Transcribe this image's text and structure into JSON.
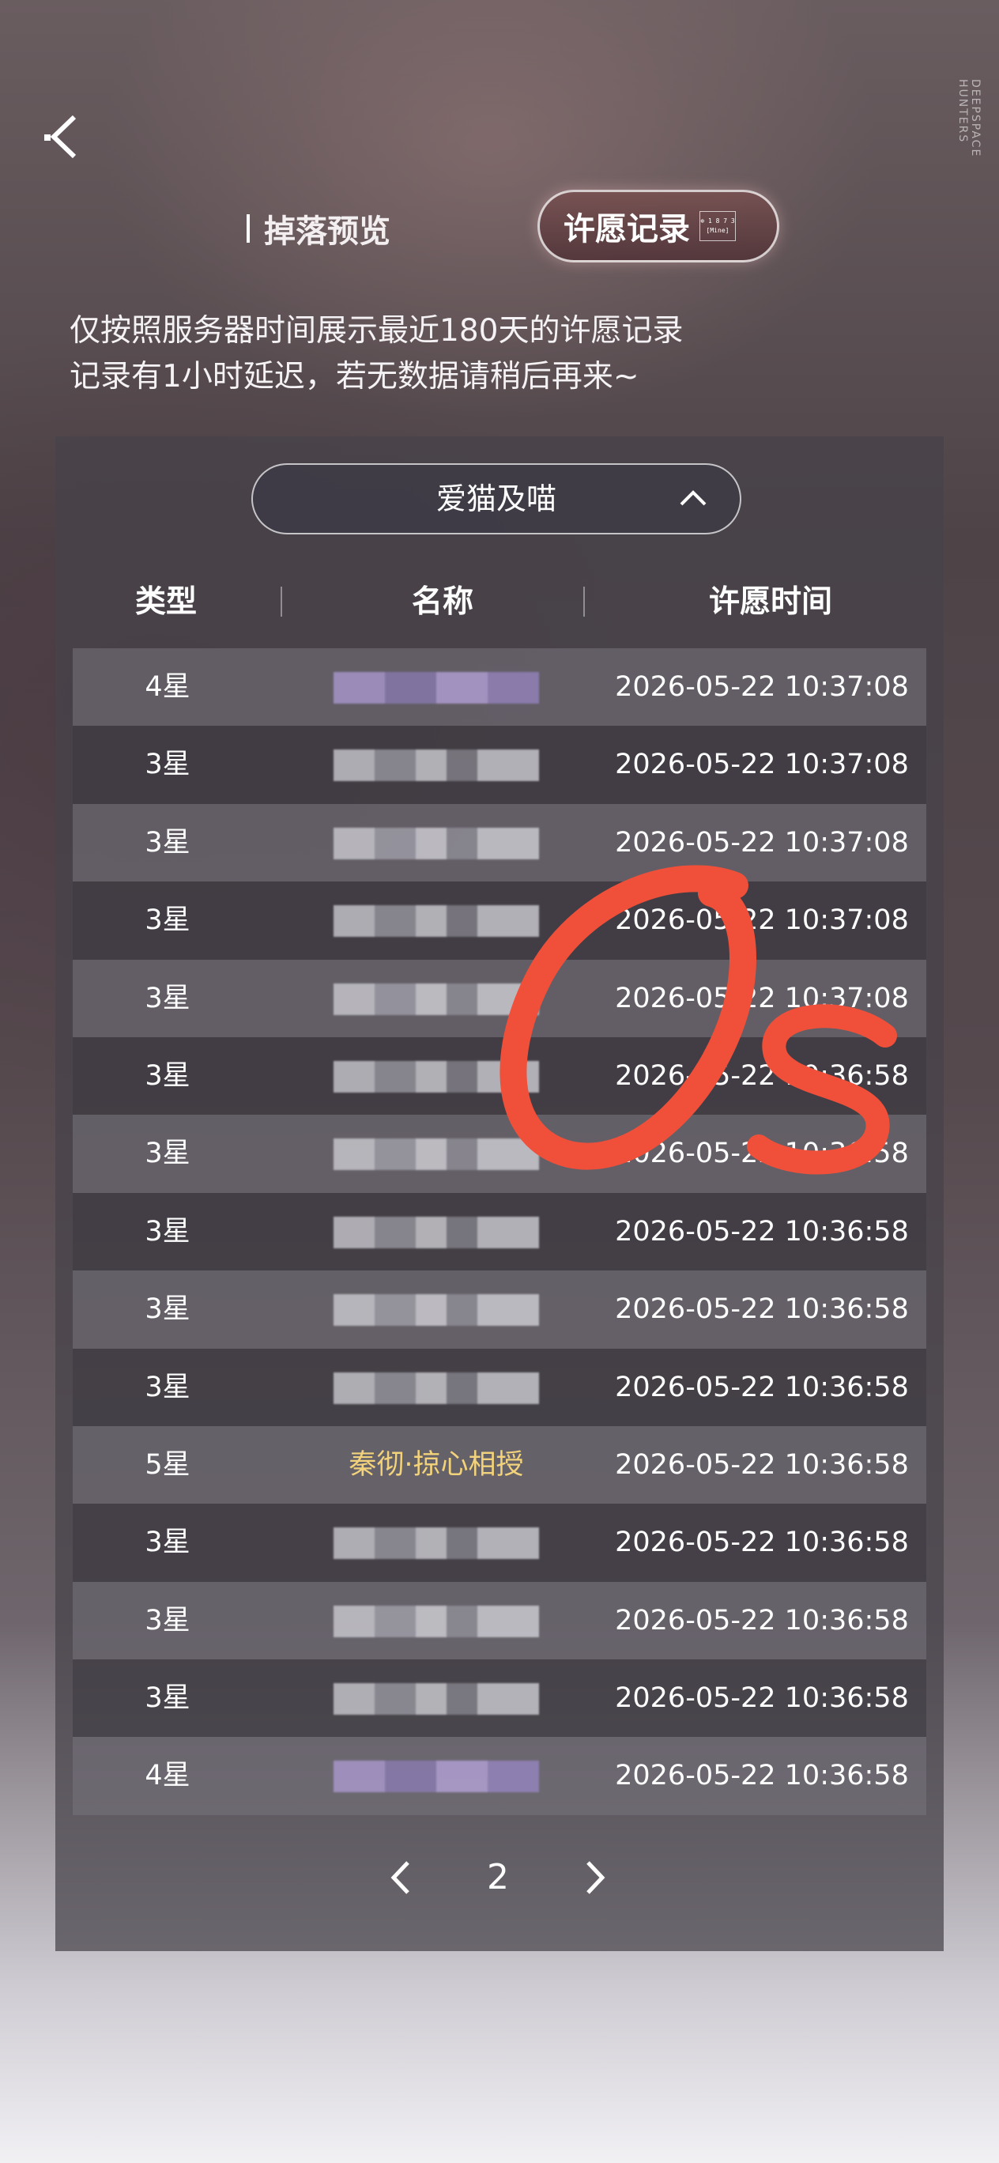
{
  "header": {
    "tabs": [
      {
        "label": "掉落预览"
      },
      {
        "label": "许愿记录",
        "mini_tag_line1": "⊕ 1 8 7 3",
        "mini_tag_line2": "[Mine]"
      }
    ],
    "side_brand": "DEEPSPACE HUNTERS"
  },
  "notice": {
    "line1": "仅按照服务器时间展示最近180天的许愿记录",
    "line2": "记录有1小时延迟，若无数据请稍后再来~"
  },
  "pool_selector": {
    "value": "爱猫及喵"
  },
  "table": {
    "headers": [
      "类型",
      "名称",
      "许愿时间"
    ],
    "rows": [
      {
        "type": "4星",
        "name": "",
        "time": "2026-05-22 10:37:08",
        "blur": "purple"
      },
      {
        "type": "3星",
        "name": "",
        "time": "2026-05-22 10:37:08",
        "blur": "grey"
      },
      {
        "type": "3星",
        "name": "",
        "time": "2026-05-22 10:37:08",
        "blur": "grey"
      },
      {
        "type": "3星",
        "name": "",
        "time": "2026-05-22 10:37:08",
        "blur": "grey"
      },
      {
        "type": "3星",
        "name": "",
        "time": "2026-05-22 10:37:08",
        "blur": "grey"
      },
      {
        "type": "3星",
        "name": "",
        "time": "2026-05-22 10:36:58",
        "blur": "grey"
      },
      {
        "type": "3星",
        "name": "",
        "time": "2026-05-22 10:36:58",
        "blur": "grey"
      },
      {
        "type": "3星",
        "name": "",
        "time": "2026-05-22 10:36:58",
        "blur": "grey"
      },
      {
        "type": "3星",
        "name": "",
        "time": "2026-05-22 10:36:58",
        "blur": "grey"
      },
      {
        "type": "3星",
        "name": "",
        "time": "2026-05-22 10:36:58",
        "blur": "grey"
      },
      {
        "type": "5星",
        "name": "秦彻·掠心相授",
        "time": "2026-05-22 10:36:58",
        "blur": "none"
      },
      {
        "type": "3星",
        "name": "",
        "time": "2026-05-22 10:36:58",
        "blur": "grey"
      },
      {
        "type": "3星",
        "name": "",
        "time": "2026-05-22 10:36:58",
        "blur": "grey"
      },
      {
        "type": "3星",
        "name": "",
        "time": "2026-05-22 10:36:58",
        "blur": "grey"
      },
      {
        "type": "4星",
        "name": "",
        "time": "2026-05-22 10:36:58",
        "blur": "purple"
      }
    ]
  },
  "pager": {
    "page": "2"
  },
  "colors": {
    "gold": "#f2d27a",
    "scribble": "#f0503a"
  }
}
